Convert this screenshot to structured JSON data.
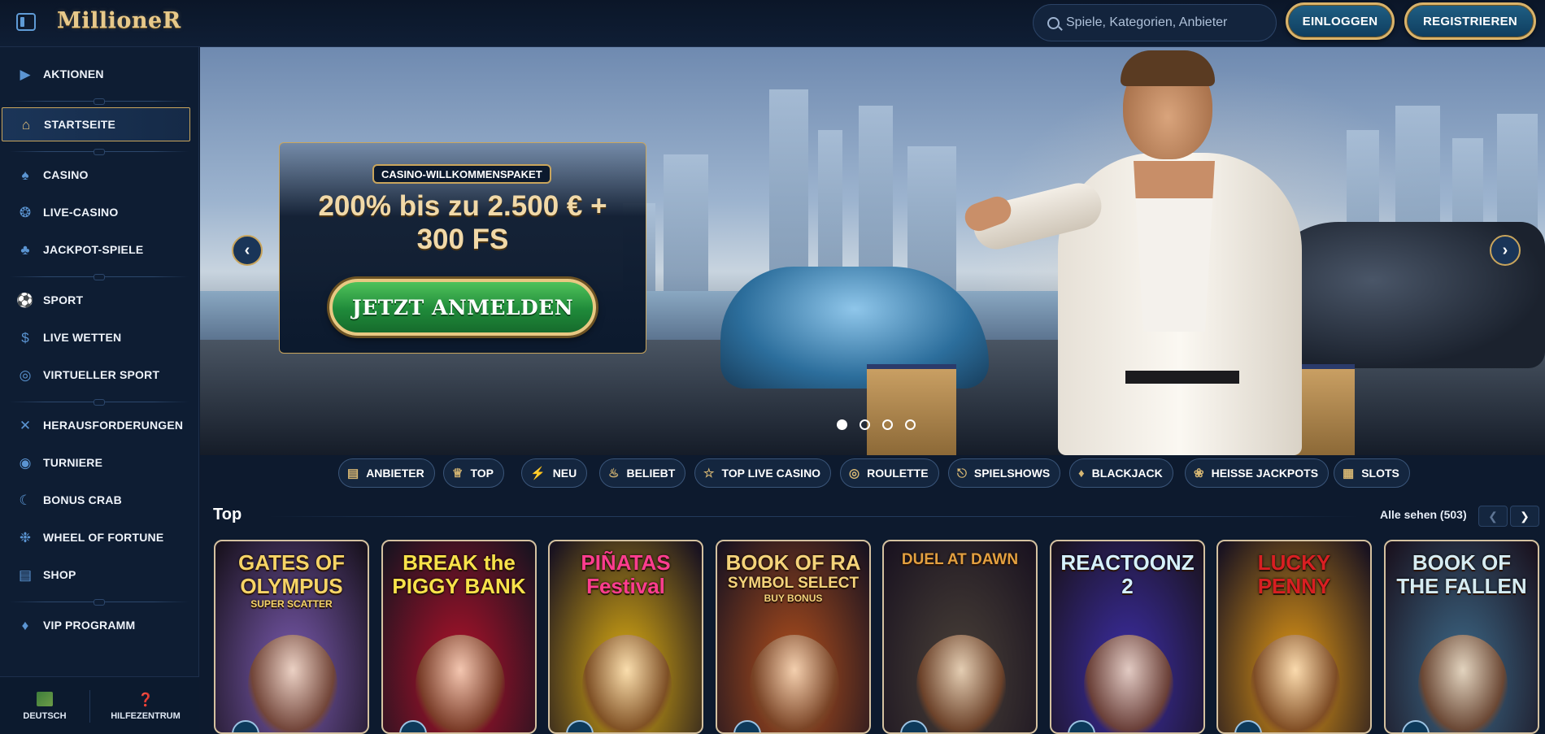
{
  "header": {
    "logo": "MillioneR",
    "search_placeholder": "Spiele, Kategorien, Anbieter",
    "login_label": "EINLOGGEN",
    "register_label": "REGISTRIEREN"
  },
  "sidebar": {
    "items": [
      {
        "label": "AKTIONEN",
        "icon": "megaphone-icon"
      },
      {
        "label": "STARTSEITE",
        "icon": "home-icon"
      },
      {
        "label": "CASINO",
        "icon": "spade-icon"
      },
      {
        "label": "LIVE-CASINO",
        "icon": "chip-icon"
      },
      {
        "label": "JACKPOT-SPIELE",
        "icon": "clover-icon"
      },
      {
        "label": "SPORT",
        "icon": "football-icon"
      },
      {
        "label": "LIVE WETTEN",
        "icon": "dollar-coin-icon"
      },
      {
        "label": "VIRTUELLER SPORT",
        "icon": "target-icon"
      },
      {
        "label": "HERAUSFORDERUNGEN",
        "icon": "crossed-swords-icon"
      },
      {
        "label": "TURNIERE",
        "icon": "medal-icon"
      },
      {
        "label": "BONUS CRAB",
        "icon": "crab-claw-icon"
      },
      {
        "label": "WHEEL OF FORTUNE",
        "icon": "wheel-icon"
      },
      {
        "label": "SHOP",
        "icon": "basket-icon"
      },
      {
        "label": "VIP PROGRAMM",
        "icon": "diamond-icon"
      }
    ],
    "footer": {
      "language_label": "DEUTSCH",
      "help_label": "HILFEZENTRUM"
    }
  },
  "hero": {
    "tag": "CASINO-WILLKOMMENSPAKET",
    "title_line1": "200% bis zu 2.500 € +",
    "title_line2": "300 FS",
    "cta_label": "JETZT ANMELDEN",
    "slide_count": 4,
    "active_slide": 1
  },
  "categories": [
    {
      "label": "ANBIETER",
      "icon": "book-icon"
    },
    {
      "label": "TOP",
      "icon": "crown-icon"
    },
    {
      "label": "NEU",
      "icon": "lightning-icon"
    },
    {
      "label": "BELIEBT",
      "icon": "flame-icon"
    },
    {
      "label": "TOP LIVE CASINO",
      "icon": "star-icon"
    },
    {
      "label": "ROULETTE",
      "icon": "roulette-icon"
    },
    {
      "label": "SPIELSHOWS",
      "icon": "microphone-icon"
    },
    {
      "label": "BLACKJACK",
      "icon": "cards-icon"
    },
    {
      "label": "HEISSE JACKPOTS",
      "icon": "chili-icon"
    },
    {
      "label": "SLOTS",
      "icon": "slot-machine-icon"
    }
  ],
  "section": {
    "title": "Top",
    "see_all": "Alle sehen (503)"
  },
  "games": [
    {
      "title": "Gates of Olympus Super Scatter",
      "line1": "GATES OF",
      "line2": "OLYMPUS",
      "line3": "SUPER SCATTER",
      "bg": "#7b5bb0",
      "fg": "#f6d466"
    },
    {
      "title": "Break the Piggy Bank",
      "line1": "BREAK the",
      "line2": "PIGGY BANK",
      "line3": "",
      "bg": "#b3122a",
      "fg": "#f8e24a"
    },
    {
      "title": "Piñatas Festival",
      "line1": "PIÑATAS",
      "line2": "Festival",
      "line3": "",
      "bg": "#e0b012",
      "fg": "#ff3d8f"
    },
    {
      "title": "Book of Ra Symbol Select Buy Bonus",
      "line1": "BOOK OF RA",
      "line2": "SYMBOL SELECT",
      "line3": "BUY BONUS",
      "bg": "#b4501c",
      "fg": "#f4d37a"
    },
    {
      "title": "Duel at Dawn",
      "line1": "DUEL AT DAWN",
      "line2": "",
      "line3": "",
      "bg": "#4a4138",
      "fg": "#e3a040"
    },
    {
      "title": "Reactoonz 2",
      "line1": "REACTOONZ",
      "line2": "2",
      "line3": "",
      "bg": "#3d2ea8",
      "fg": "#d6f1ff"
    },
    {
      "title": "Lucky Penny",
      "line1": "LUCKY",
      "line2": "PENNY",
      "line3": "",
      "bg": "#e49a16",
      "fg": "#d81f22"
    },
    {
      "title": "Book of the Fallen",
      "line1": "BOOK OF",
      "line2": "THE FALLEN",
      "line3": "",
      "bg": "#3e6b8a",
      "fg": "#d6ecf2"
    }
  ]
}
